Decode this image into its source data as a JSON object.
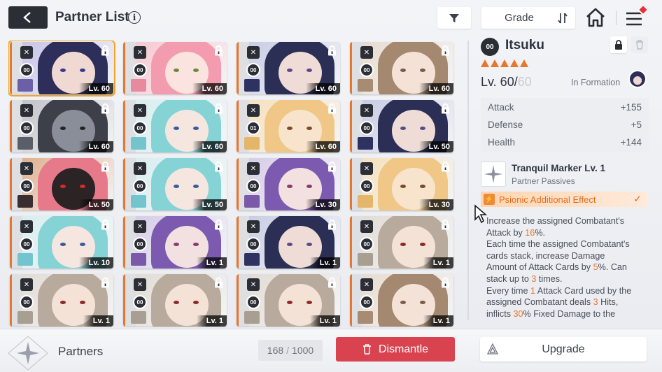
{
  "header": {
    "title": "Partner List",
    "info_glyph": "i",
    "sort_label": "Grade"
  },
  "cards": [
    {
      "level": "Lv. 60",
      "dup": "00",
      "theme": "#6b5fa8",
      "skin": "#f1d9d3",
      "hair": "#2d2f5a",
      "eyes": "#3a3a8a",
      "bg": "#c8c4e8",
      "selected": true
    },
    {
      "level": "Lv. 60",
      "dup": "00",
      "theme": "#e78aa0",
      "skin": "#fbe3df",
      "hair": "#f39cb0",
      "eyes": "#6a8a3a",
      "bg": "#f7c9d1"
    },
    {
      "level": "Lv. 60",
      "dup": "00",
      "theme": "#2e3260",
      "skin": "#efdcd6",
      "hair": "#2c2f55",
      "eyes": "#5a4a8a",
      "bg": "#c9cde4"
    },
    {
      "level": "Lv. 60",
      "dup": "00",
      "theme": "#a88b73",
      "skin": "#f4e2d6",
      "hair": "#a48870",
      "eyes": "#7a5a4a",
      "bg": "#e8dcd0"
    },
    {
      "level": "Lv. 60",
      "dup": "00",
      "theme": "#5a5e68",
      "skin": "#8a8e98",
      "hair": "#3d4048",
      "eyes": "#222222",
      "bg": "#c2c4ca"
    },
    {
      "level": "Lv. 60",
      "dup": "00",
      "theme": "#73c4cc",
      "skin": "#f6e6e0",
      "hair": "#86d3d6",
      "eyes": "#3a5a9a",
      "bg": "#d8eef0"
    },
    {
      "level": "Lv. 60",
      "dup": "01",
      "theme": "#e4b66a",
      "skin": "#f8e4cc",
      "hair": "#f0c787",
      "eyes": "#7a4a2a",
      "bg": "#f6e1bd"
    },
    {
      "level": "Lv. 50",
      "dup": "00",
      "theme": "#2e3260",
      "skin": "#efdcd6",
      "hair": "#2c2f55",
      "eyes": "#5a4a8a",
      "bg": "#c9cde4"
    },
    {
      "level": "Lv. 50",
      "dup": "00",
      "theme": "#3a2f30",
      "skin": "#2b2324",
      "hair": "#e77a8a",
      "eyes": "#d42a2a",
      "bg": "#e0b090"
    },
    {
      "level": "Lv. 50",
      "dup": "00",
      "theme": "#73c4cc",
      "skin": "#f6e6e0",
      "hair": "#86d3d6",
      "eyes": "#3a5a9a",
      "bg": "#d8eef0"
    },
    {
      "level": "Lv. 30",
      "dup": "00",
      "theme": "#7a5aa8",
      "skin": "#f3e0e0",
      "hair": "#7c5ab0",
      "eyes": "#8a3a6a",
      "bg": "#d6cde8"
    },
    {
      "level": "Lv. 30",
      "dup": "00",
      "theme": "#e4b66a",
      "skin": "#f8e4cc",
      "hair": "#f0c787",
      "eyes": "#7a4a2a",
      "bg": "#f6e1bd"
    },
    {
      "level": "Lv. 10",
      "dup": "00",
      "theme": "#73c4cc",
      "skin": "#f6e6e0",
      "hair": "#86d3d6",
      "eyes": "#3a5a9a",
      "bg": "#d8eef0"
    },
    {
      "level": "Lv. 1",
      "dup": "00",
      "theme": "#7a5aa8",
      "skin": "#f3e0e0",
      "hair": "#7c5ab0",
      "eyes": "#8a3a6a",
      "bg": "#d6cde8"
    },
    {
      "level": "Lv. 1",
      "dup": "00",
      "theme": "#2e3260",
      "skin": "#efdcd6",
      "hair": "#2c2f55",
      "eyes": "#5a4a8a",
      "bg": "#c9cde4"
    },
    {
      "level": "Lv. 1",
      "dup": "00",
      "theme": "#a99e92",
      "skin": "#f4e2d6",
      "hair": "#b8aa9c",
      "eyes": "#8a2a2a",
      "bg": "#e2dcd5"
    },
    {
      "level": "Lv. 1",
      "dup": "00",
      "theme": "#a99e92",
      "skin": "#f4e2d6",
      "hair": "#b8aa9c",
      "eyes": "#8a2a2a",
      "bg": "#e2dcd5"
    },
    {
      "level": "Lv. 1",
      "dup": "00",
      "theme": "#a99e92",
      "skin": "#f4e2d6",
      "hair": "#b8aa9c",
      "eyes": "#8a2a2a",
      "bg": "#e2dcd5"
    },
    {
      "level": "Lv. 1",
      "dup": "00",
      "theme": "#a99e92",
      "skin": "#f4e2d6",
      "hair": "#b8aa9c",
      "eyes": "#8a2a2a",
      "bg": "#e2dcd5"
    },
    {
      "level": "Lv. 1",
      "dup": "00",
      "theme": "#a88b73",
      "skin": "#f4e2d6",
      "hair": "#a48870",
      "eyes": "#7a5a4a",
      "bg": "#e8dcd0"
    }
  ],
  "detail": {
    "dup": "00",
    "name": "Itsuku",
    "stars": 5,
    "level": "Lv. 60/",
    "level_max": "60",
    "formation": "In Formation",
    "stats": [
      {
        "label": "Attack",
        "value": "+155"
      },
      {
        "label": "Defense",
        "value": "+5"
      },
      {
        "label": "Health",
        "value": "+144"
      }
    ],
    "passive_name": "Tranquil Marker Lv. 1",
    "passive_sub": "Partner Passives",
    "effect": "Psionic Additional Effect",
    "desc_lines": [
      [
        "Increase the assigned Combatant's"
      ],
      [
        "Attack by ",
        {
          "o": "16"
        },
        "%."
      ],
      [
        "Each time the assigned Combatant's"
      ],
      [
        "cards stack, increase Damage"
      ],
      [
        "Amount of Attack Cards by ",
        {
          "o": "5"
        },
        "%. Can"
      ],
      [
        "stack up to ",
        {
          "o": "3"
        },
        " times."
      ],
      [
        "Every time ",
        {
          "o": "1"
        },
        " Attack Card used by the"
      ],
      [
        "assigned Combatant deals ",
        {
          "o": "3"
        },
        " Hits,"
      ],
      [
        "inflicts ",
        {
          "o": "30"
        },
        "% Fixed Damage to the"
      ]
    ]
  },
  "footer": {
    "title": "Partners",
    "count": "168",
    "sep": "/",
    "capacity": "1000",
    "dismantle": "Dismantle",
    "upgrade": "Upgrade"
  },
  "colors": {
    "accent": "#e8772e",
    "danger": "#d9434f",
    "dark": "#2b2e35"
  }
}
